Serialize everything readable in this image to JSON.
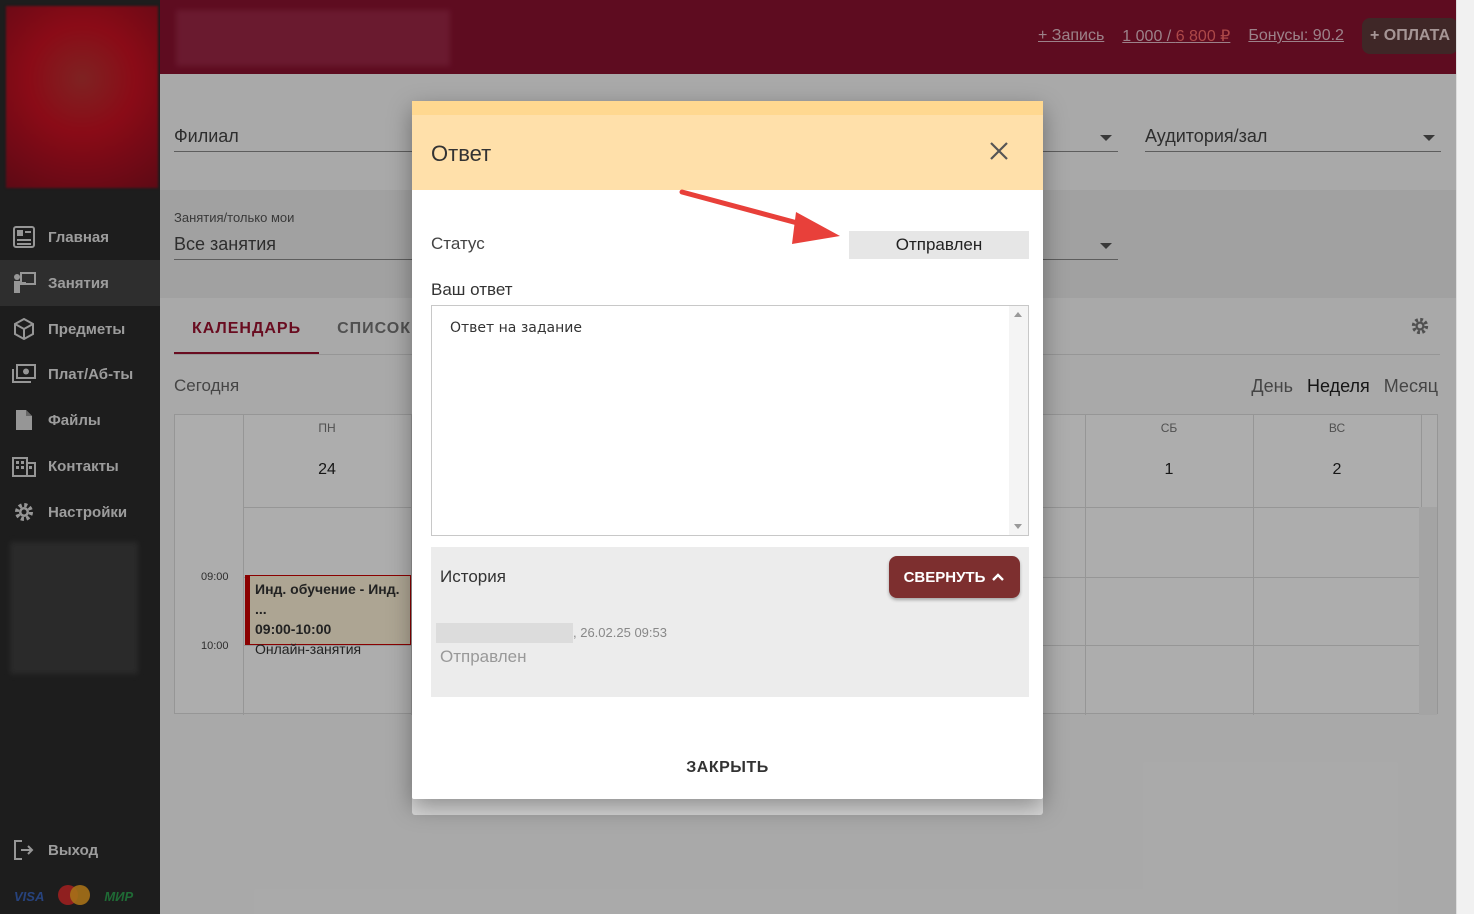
{
  "header": {
    "add_record": "+ Запись",
    "balance_positive": "1 000",
    "balance_sep": " / ",
    "balance_negative": "6 800 ₽",
    "bonuses": "Бонусы: 90.2",
    "pay_button": "+ ОПЛАТА"
  },
  "sidebar": {
    "items": [
      {
        "label": "Главная",
        "icon": "dashboard-icon"
      },
      {
        "label": "Занятия",
        "icon": "lesson-icon"
      },
      {
        "label": "Предметы",
        "icon": "cube-icon"
      },
      {
        "label": "Плат/Аб-ты",
        "icon": "payment-icon"
      },
      {
        "label": "Файлы",
        "icon": "file-icon"
      },
      {
        "label": "Контакты",
        "icon": "contacts-icon"
      },
      {
        "label": "Настройки",
        "icon": "gear-icon"
      }
    ],
    "logout": "Выход",
    "payment_logos": [
      "VISA",
      "MasterCard",
      "МИР"
    ]
  },
  "filters": {
    "branch": "Филиал",
    "room": "Аудитория/зал",
    "lessons_label": "Занятия/только мои",
    "lessons_value": "Все занятия"
  },
  "tabs": [
    "КАЛЕНДАРЬ",
    "СПИСОК"
  ],
  "calendar": {
    "today": "Сегодня",
    "views": [
      "День",
      "Неделя",
      "Месяц"
    ],
    "selected_view": "Неделя",
    "days": [
      {
        "name": "ПН",
        "num": "24"
      },
      {
        "name": "СБ",
        "num": "1"
      },
      {
        "name": "ВС",
        "num": "2"
      }
    ],
    "times": [
      "09:00",
      "10:00"
    ],
    "event": {
      "title": "Инд. обучение - Инд. ...",
      "time": "09:00-10:00",
      "type": "Онлайн-занятия"
    }
  },
  "modal": {
    "title": "Ответ",
    "status_label": "Статус",
    "status_value": "Отправлен",
    "answer_label": "Ваш ответ",
    "answer_text": "Ответ на задание",
    "history_title": "История",
    "collapse_button": "СВЕРНУТЬ",
    "history_entry": {
      "date": ", 26.02.25 09:53",
      "status": "Отправлен"
    },
    "close_button": "ЗАКРЫТЬ"
  },
  "colors": {
    "brand": "#8b1230",
    "modal_header": "#ffe0aa",
    "collapse_button": "#7d2f2f",
    "annotation_arrow": "#e8403a"
  }
}
